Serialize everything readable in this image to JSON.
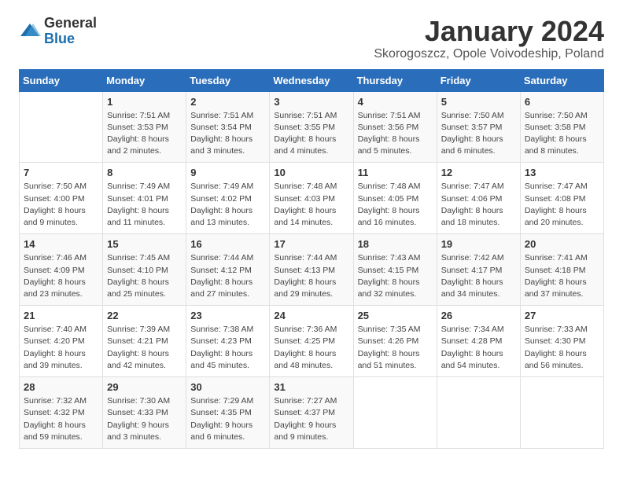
{
  "logo": {
    "general": "General",
    "blue": "Blue"
  },
  "title": "January 2024",
  "subtitle": "Skorogoszcz, Opole Voivodeship, Poland",
  "days_of_week": [
    "Sunday",
    "Monday",
    "Tuesday",
    "Wednesday",
    "Thursday",
    "Friday",
    "Saturday"
  ],
  "weeks": [
    [
      {
        "day": "",
        "detail": ""
      },
      {
        "day": "1",
        "detail": "Sunrise: 7:51 AM\nSunset: 3:53 PM\nDaylight: 8 hours\nand 2 minutes."
      },
      {
        "day": "2",
        "detail": "Sunrise: 7:51 AM\nSunset: 3:54 PM\nDaylight: 8 hours\nand 3 minutes."
      },
      {
        "day": "3",
        "detail": "Sunrise: 7:51 AM\nSunset: 3:55 PM\nDaylight: 8 hours\nand 4 minutes."
      },
      {
        "day": "4",
        "detail": "Sunrise: 7:51 AM\nSunset: 3:56 PM\nDaylight: 8 hours\nand 5 minutes."
      },
      {
        "day": "5",
        "detail": "Sunrise: 7:50 AM\nSunset: 3:57 PM\nDaylight: 8 hours\nand 6 minutes."
      },
      {
        "day": "6",
        "detail": "Sunrise: 7:50 AM\nSunset: 3:58 PM\nDaylight: 8 hours\nand 8 minutes."
      }
    ],
    [
      {
        "day": "7",
        "detail": "Sunrise: 7:50 AM\nSunset: 4:00 PM\nDaylight: 8 hours\nand 9 minutes."
      },
      {
        "day": "8",
        "detail": "Sunrise: 7:49 AM\nSunset: 4:01 PM\nDaylight: 8 hours\nand 11 minutes."
      },
      {
        "day": "9",
        "detail": "Sunrise: 7:49 AM\nSunset: 4:02 PM\nDaylight: 8 hours\nand 13 minutes."
      },
      {
        "day": "10",
        "detail": "Sunrise: 7:48 AM\nSunset: 4:03 PM\nDaylight: 8 hours\nand 14 minutes."
      },
      {
        "day": "11",
        "detail": "Sunrise: 7:48 AM\nSunset: 4:05 PM\nDaylight: 8 hours\nand 16 minutes."
      },
      {
        "day": "12",
        "detail": "Sunrise: 7:47 AM\nSunset: 4:06 PM\nDaylight: 8 hours\nand 18 minutes."
      },
      {
        "day": "13",
        "detail": "Sunrise: 7:47 AM\nSunset: 4:08 PM\nDaylight: 8 hours\nand 20 minutes."
      }
    ],
    [
      {
        "day": "14",
        "detail": "Sunrise: 7:46 AM\nSunset: 4:09 PM\nDaylight: 8 hours\nand 23 minutes."
      },
      {
        "day": "15",
        "detail": "Sunrise: 7:45 AM\nSunset: 4:10 PM\nDaylight: 8 hours\nand 25 minutes."
      },
      {
        "day": "16",
        "detail": "Sunrise: 7:44 AM\nSunset: 4:12 PM\nDaylight: 8 hours\nand 27 minutes."
      },
      {
        "day": "17",
        "detail": "Sunrise: 7:44 AM\nSunset: 4:13 PM\nDaylight: 8 hours\nand 29 minutes."
      },
      {
        "day": "18",
        "detail": "Sunrise: 7:43 AM\nSunset: 4:15 PM\nDaylight: 8 hours\nand 32 minutes."
      },
      {
        "day": "19",
        "detail": "Sunrise: 7:42 AM\nSunset: 4:17 PM\nDaylight: 8 hours\nand 34 minutes."
      },
      {
        "day": "20",
        "detail": "Sunrise: 7:41 AM\nSunset: 4:18 PM\nDaylight: 8 hours\nand 37 minutes."
      }
    ],
    [
      {
        "day": "21",
        "detail": "Sunrise: 7:40 AM\nSunset: 4:20 PM\nDaylight: 8 hours\nand 39 minutes."
      },
      {
        "day": "22",
        "detail": "Sunrise: 7:39 AM\nSunset: 4:21 PM\nDaylight: 8 hours\nand 42 minutes."
      },
      {
        "day": "23",
        "detail": "Sunrise: 7:38 AM\nSunset: 4:23 PM\nDaylight: 8 hours\nand 45 minutes."
      },
      {
        "day": "24",
        "detail": "Sunrise: 7:36 AM\nSunset: 4:25 PM\nDaylight: 8 hours\nand 48 minutes."
      },
      {
        "day": "25",
        "detail": "Sunrise: 7:35 AM\nSunset: 4:26 PM\nDaylight: 8 hours\nand 51 minutes."
      },
      {
        "day": "26",
        "detail": "Sunrise: 7:34 AM\nSunset: 4:28 PM\nDaylight: 8 hours\nand 54 minutes."
      },
      {
        "day": "27",
        "detail": "Sunrise: 7:33 AM\nSunset: 4:30 PM\nDaylight: 8 hours\nand 56 minutes."
      }
    ],
    [
      {
        "day": "28",
        "detail": "Sunrise: 7:32 AM\nSunset: 4:32 PM\nDaylight: 8 hours\nand 59 minutes."
      },
      {
        "day": "29",
        "detail": "Sunrise: 7:30 AM\nSunset: 4:33 PM\nDaylight: 9 hours\nand 3 minutes."
      },
      {
        "day": "30",
        "detail": "Sunrise: 7:29 AM\nSunset: 4:35 PM\nDaylight: 9 hours\nand 6 minutes."
      },
      {
        "day": "31",
        "detail": "Sunrise: 7:27 AM\nSunset: 4:37 PM\nDaylight: 9 hours\nand 9 minutes."
      },
      {
        "day": "",
        "detail": ""
      },
      {
        "day": "",
        "detail": ""
      },
      {
        "day": "",
        "detail": ""
      }
    ]
  ]
}
